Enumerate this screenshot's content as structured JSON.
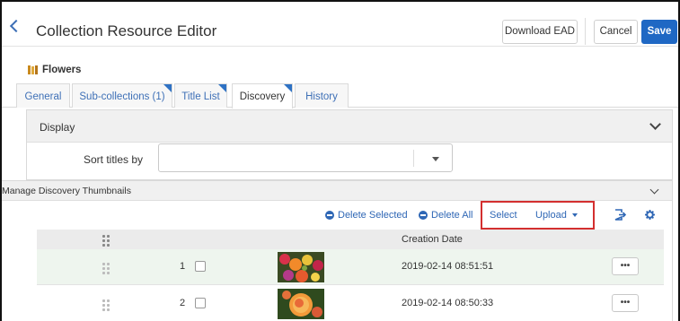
{
  "header": {
    "title": "Collection Resource Editor",
    "download_label": "Download EAD",
    "cancel_label": "Cancel",
    "save_label": "Save"
  },
  "record": {
    "title": "Flowers"
  },
  "tabs": [
    {
      "label": "General"
    },
    {
      "label": "Sub-collections (1)"
    },
    {
      "label": "Title List"
    },
    {
      "label": "Discovery"
    },
    {
      "label": "History"
    }
  ],
  "display_panel": {
    "title": "Display",
    "sort_label": "Sort titles by",
    "sort_value": ""
  },
  "thumbnails_panel": {
    "title": "Manage Discovery Thumbnails",
    "delete_selected": "Delete Selected",
    "delete_all": "Delete All",
    "select": "Select",
    "upload": "Upload",
    "column_creation_date": "Creation Date",
    "rows": [
      {
        "num": "1",
        "date": "2019-02-14 08:51:51",
        "menu": "•••"
      },
      {
        "num": "2",
        "date": "2019-02-14 08:50:33",
        "menu": "•••"
      }
    ]
  },
  "colors": {
    "accent": "#1f68c4",
    "link": "#2f67b5",
    "highlight": "#d32f2f",
    "selected_row": "#eef5ee"
  }
}
